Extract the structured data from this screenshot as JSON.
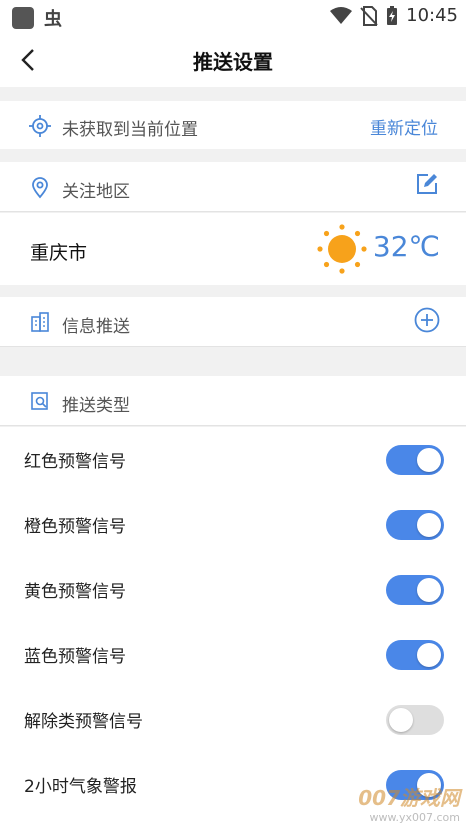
{
  "status_bar": {
    "app_glyph": "虫",
    "time": "10:45"
  },
  "nav": {
    "title": "推送设置"
  },
  "location": {
    "status_text": "未获取到当前位置",
    "relocate_label": "重新定位"
  },
  "follow": {
    "title": "关注地区"
  },
  "weather": {
    "city": "重庆市",
    "temperature": "32℃",
    "condition_icon": "sun-icon"
  },
  "info_push": {
    "title": "信息推送"
  },
  "push_type": {
    "title": "推送类型"
  },
  "switches": [
    {
      "label": "红色预警信号",
      "on": true
    },
    {
      "label": "橙色预警信号",
      "on": true
    },
    {
      "label": "黄色预警信号",
      "on": true
    },
    {
      "label": "蓝色预警信号",
      "on": true
    },
    {
      "label": "解除类预警信号",
      "on": false
    },
    {
      "label": "2小时气象警报",
      "on": true
    }
  ],
  "watermark": {
    "brand": "007游戏网",
    "url": "www.yx007.com"
  },
  "colors": {
    "accent": "#4a87e8",
    "link": "#4a87d8",
    "sun": "#f7a21b",
    "toggle_off": "#dedede"
  }
}
